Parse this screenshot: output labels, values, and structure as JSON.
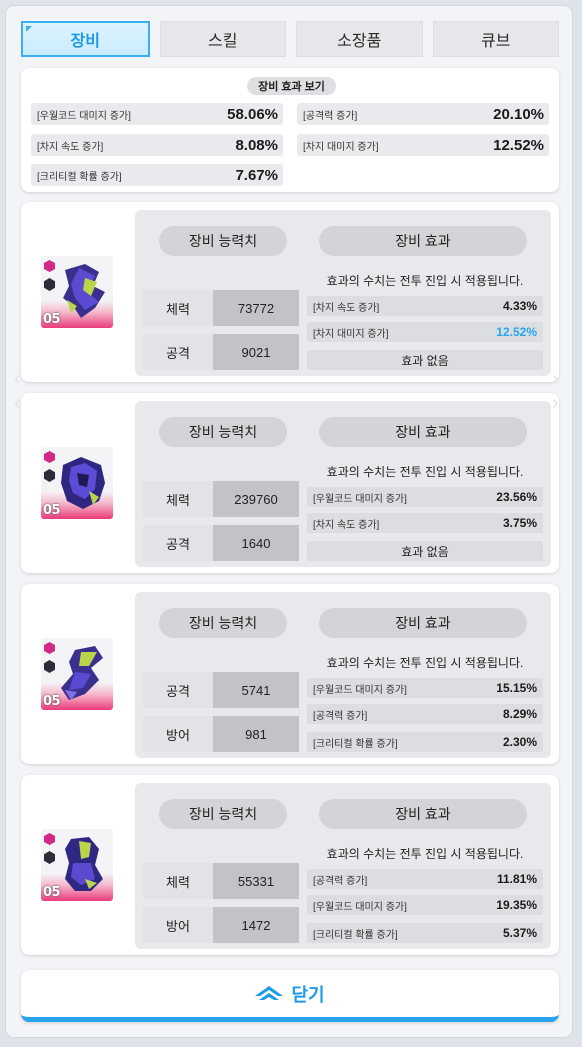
{
  "tabs": [
    {
      "label": "장비",
      "active": true
    },
    {
      "label": "스킬",
      "active": false
    },
    {
      "label": "소장품",
      "active": false
    },
    {
      "label": "큐브",
      "active": false
    }
  ],
  "summary": {
    "title": "장비 효과 보기",
    "rows": [
      {
        "label": "[우월코드 대미지 증가]",
        "value": "58.06%"
      },
      {
        "label": "[공격력 증가]",
        "value": "20.10%"
      },
      {
        "label": "[차지 속도 증가]",
        "value": "8.08%"
      },
      {
        "label": "[차지 대미지 증가]",
        "value": "12.52%"
      },
      {
        "label": "[크리티컬 확률 증가]",
        "value": "7.67%"
      }
    ]
  },
  "labels": {
    "stats_header": "장비 능력치",
    "effects_header": "장비 효과",
    "notice": "효과의 수치는 전투 진입 시 적용됩니다.",
    "no_effect": "효과 없음",
    "level": "05"
  },
  "equipment": [
    {
      "stats": [
        {
          "name": "체력",
          "value": "73772"
        },
        {
          "name": "공격",
          "value": "9021"
        }
      ],
      "effects": [
        {
          "label": "[차지 속도 증가]",
          "value": "4.33%"
        },
        {
          "label": "[차지 대미지 증가]",
          "value": "12.52%"
        },
        {
          "label": "효과 없음",
          "value": ""
        }
      ]
    },
    {
      "stats": [
        {
          "name": "체력",
          "value": "239760"
        },
        {
          "name": "공격",
          "value": "1640"
        }
      ],
      "effects": [
        {
          "label": "[우월코드 대미지 증가]",
          "value": "23.56%"
        },
        {
          "label": "[차지 속도 증가]",
          "value": "3.75%"
        },
        {
          "label": "효과 없음",
          "value": ""
        }
      ]
    },
    {
      "stats": [
        {
          "name": "공격",
          "value": "5741"
        },
        {
          "name": "방어",
          "value": "981"
        }
      ],
      "effects": [
        {
          "label": "[우월코드 대미지 증가]",
          "value": "15.15%"
        },
        {
          "label": "[공격력 증가]",
          "value": "8.29%"
        },
        {
          "label": "[크리티컬 확률 증가]",
          "value": "2.30%"
        }
      ]
    },
    {
      "stats": [
        {
          "name": "체력",
          "value": "55331"
        },
        {
          "name": "방어",
          "value": "1472"
        }
      ],
      "effects": [
        {
          "label": "[공격력 증가]",
          "value": "11.81%"
        },
        {
          "label": "[우월코드 대미지 증가]",
          "value": "19.35%"
        },
        {
          "label": "[크리티컬 확률 증가]",
          "value": "5.37%"
        }
      ]
    }
  ],
  "close": {
    "label": "닫기",
    "icon": "chevron-up-icon"
  },
  "colors": {
    "accent": "#1f9be6",
    "highlight": "#23a7ee",
    "rarity": "#ea3b7a"
  }
}
